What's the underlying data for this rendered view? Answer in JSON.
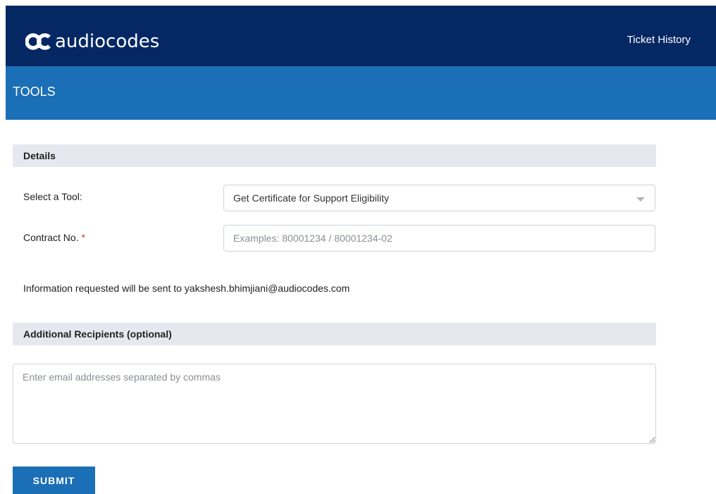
{
  "header": {
    "brand": "audiocodes",
    "nav_link": "Ticket History",
    "logo_icon": "audiocodes-logo-icon"
  },
  "page": {
    "title": "TOOLS"
  },
  "details": {
    "heading": "Details",
    "tool_label": "Select a Tool:",
    "tool_value": "Get Certificate for Support Eligibility",
    "contract_label": "Contract No.",
    "contract_required": "*",
    "contract_placeholder": "Examples: 80001234 / 80001234-02",
    "contract_value": "",
    "info_text": "Information requested will be sent to yakshesh.bhimjiani@audiocodes.com"
  },
  "recipients": {
    "heading": "Additional Recipients (optional)",
    "placeholder": "Enter email addresses separated by commas",
    "value": ""
  },
  "actions": {
    "submit_label": "SUBMIT"
  },
  "colors": {
    "topbar": "#052864",
    "subbar": "#1b6fb6",
    "section_bg": "#e7e8ef",
    "button": "#1b6fb6",
    "required": "#dd3333"
  }
}
